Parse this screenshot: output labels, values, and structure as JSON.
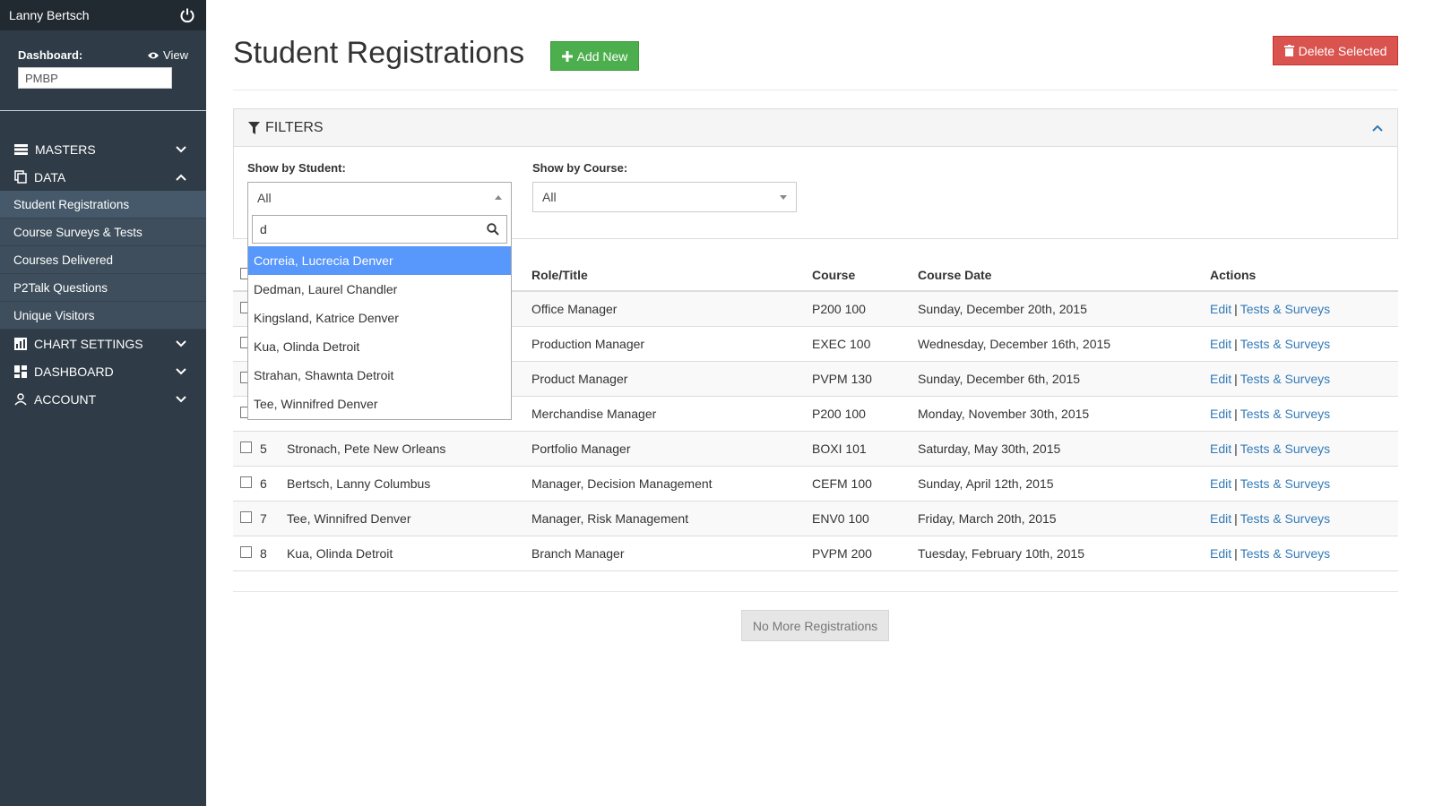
{
  "user": {
    "name": "Lanny Bertsch"
  },
  "dashboard": {
    "label": "Dashboard:",
    "view_label": "View",
    "value": "PMBP"
  },
  "nav": {
    "masters": "MASTERS",
    "data": "DATA",
    "data_items": [
      "Student Registrations",
      "Course Surveys & Tests",
      "Courses Delivered",
      "P2Talk Questions",
      "Unique Visitors"
    ],
    "chart_settings": "CHART SETTINGS",
    "dashboard": "DASHBOARD",
    "account": "ACCOUNT"
  },
  "page": {
    "title": "Student Registrations",
    "add_new": "Add New",
    "delete_selected": "Delete Selected"
  },
  "filters": {
    "title": "FILTERS",
    "student_label": "Show by Student:",
    "student_value": "All",
    "course_label": "Show by Course:",
    "course_value": "All"
  },
  "dropdown": {
    "search_value": "d",
    "options": [
      "Correia, Lucrecia Denver",
      "Dedman, Laurel Chandler",
      "Kingsland, Katrice Denver",
      "Kua, Olinda Detroit",
      "Strahan, Shawnta Detroit",
      "Tee, Winnifred Denver"
    ],
    "highlighted_index": 0
  },
  "table": {
    "headers": {
      "role": "Role/Title",
      "course": "Course",
      "date": "Course Date",
      "actions": "Actions"
    },
    "rows": [
      {
        "num": "",
        "name": "",
        "role": "Office Manager",
        "course": "P200 100",
        "date": "Sunday, December 20th, 2015"
      },
      {
        "num": "",
        "name": "",
        "role": "Production Manager",
        "course": "EXEC 100",
        "date": "Wednesday, December 16th, 2015"
      },
      {
        "num": "",
        "name": "",
        "role": "Product Manager",
        "course": "PVPM 130",
        "date": "Sunday, December 6th, 2015"
      },
      {
        "num": "",
        "name": "",
        "role": "Merchandise Manager",
        "course": "P200 100",
        "date": "Monday, November 30th, 2015"
      },
      {
        "num": "5",
        "name": "Stronach, Pete New Orleans",
        "role": "Portfolio Manager",
        "course": "BOXI 101",
        "date": "Saturday, May 30th, 2015"
      },
      {
        "num": "6",
        "name": "Bertsch, Lanny Columbus",
        "role": "Manager, Decision Management",
        "course": "CEFM 100",
        "date": "Sunday, April 12th, 2015"
      },
      {
        "num": "7",
        "name": "Tee, Winnifred Denver",
        "role": "Manager, Risk Management",
        "course": "ENV0 100",
        "date": "Friday, March 20th, 2015"
      },
      {
        "num": "8",
        "name": "Kua, Olinda Detroit",
        "role": "Branch Manager",
        "course": "PVPM 200",
        "date": "Tuesday, February 10th, 2015"
      }
    ],
    "action_edit": "Edit",
    "action_sep": "|",
    "action_tests": "Tests & Surveys"
  },
  "footer": {
    "no_more": "No More Registrations"
  },
  "colors": {
    "sidebar": "#2f3b46",
    "add": "#4cae4c",
    "delete": "#d9534f",
    "link": "#337ab7",
    "highlight": "#5897fb"
  }
}
